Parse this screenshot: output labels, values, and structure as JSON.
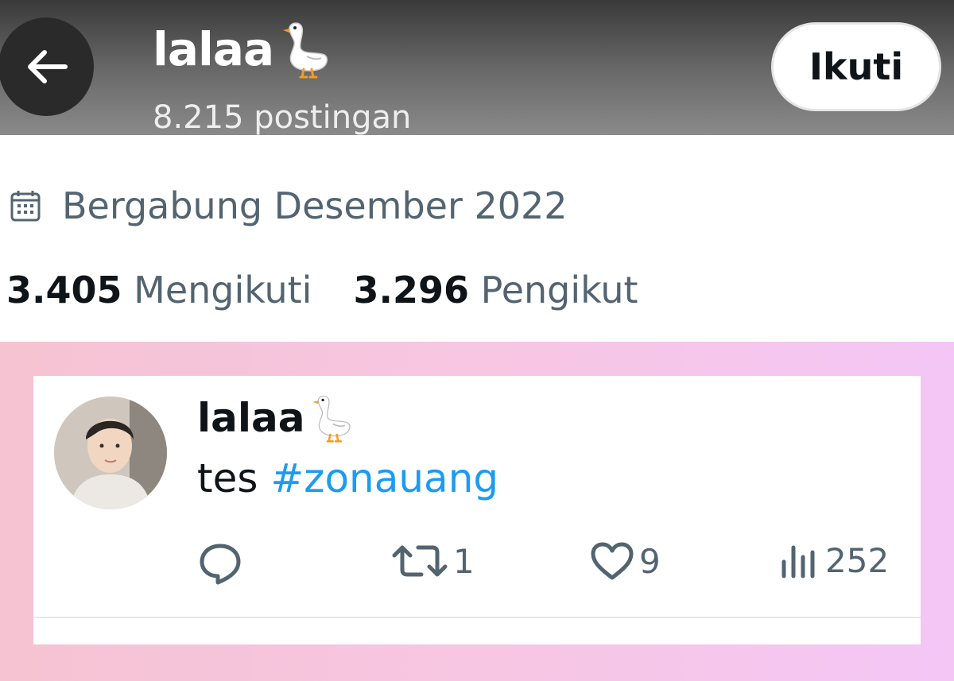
{
  "header": {
    "title": "lalaa",
    "title_emoji": "goose-icon",
    "post_count": "8.215 postingan",
    "follow_label": "Ikuti"
  },
  "profile": {
    "joined": "Bergabung Desember 2022",
    "following_count": "3.405",
    "following_label": "Mengikuti",
    "followers_count": "3.296",
    "followers_label": "Pengikut"
  },
  "tweet": {
    "name": "lalaa",
    "text_prefix": "tes ",
    "hashtag": "#zonauang",
    "retweets": "1",
    "likes": "9",
    "views": "252"
  },
  "colors": {
    "accent": "#1d9bf0",
    "text_primary": "#0f1419",
    "text_secondary": "#536471",
    "backdrop_pink": "#f6c3d2"
  }
}
